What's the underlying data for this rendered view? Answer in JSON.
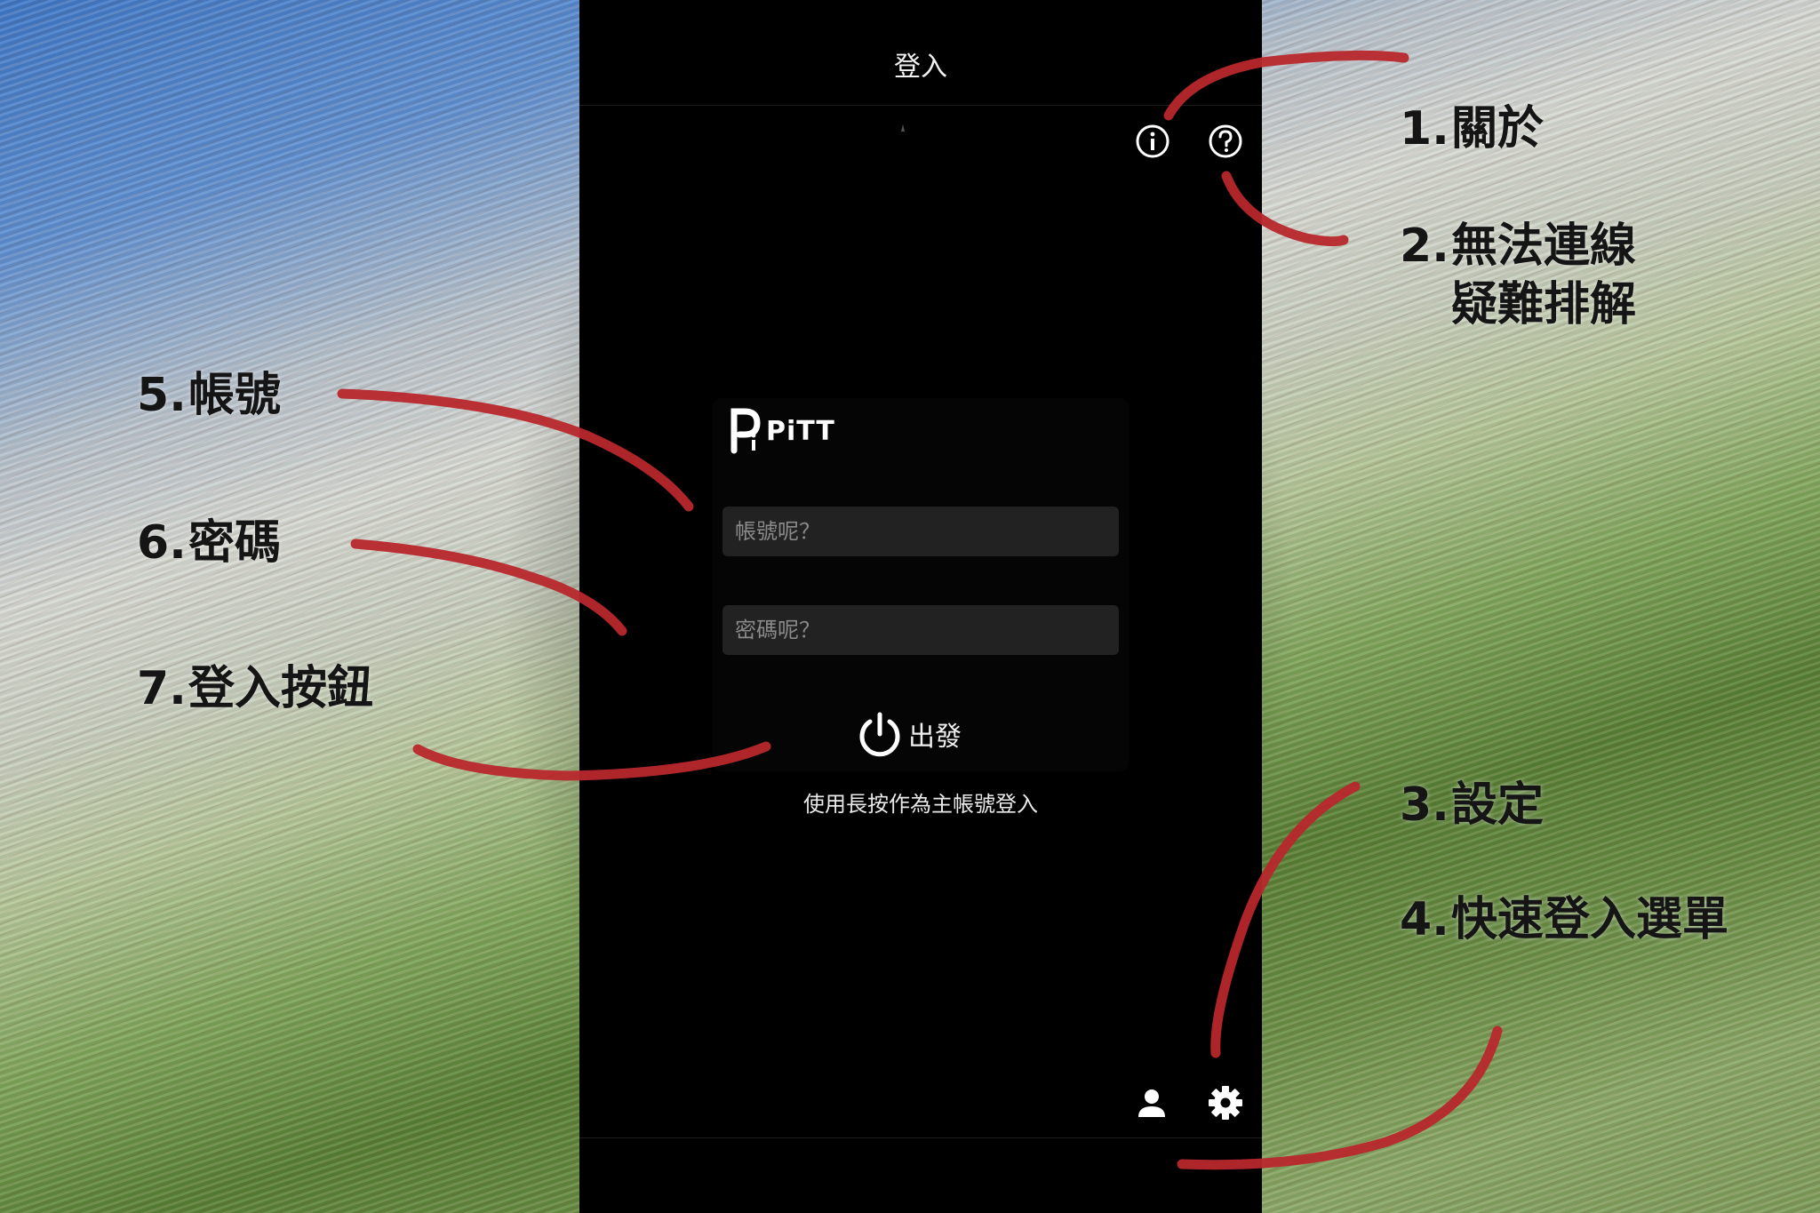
{
  "app": {
    "title": "登入",
    "logo_text": "PiTT",
    "username_placeholder": "帳號呢？",
    "password_placeholder": "密碼呢？",
    "login_button_label": "出發",
    "hint_text": "使用長按作為主帳號登入"
  },
  "icons": {
    "about": "info-icon",
    "troubleshoot": "help-icon",
    "quick_login": "person-icon",
    "settings": "gear-icon",
    "login": "power-icon"
  },
  "annotations": [
    {
      "num": "1.",
      "line1": "關於",
      "line2": ""
    },
    {
      "num": "2.",
      "line1": "無法連線",
      "line2": "疑難排解"
    },
    {
      "num": "3.",
      "line1": "設定",
      "line2": ""
    },
    {
      "num": "4.",
      "line1": "快速登入選單",
      "line2": ""
    },
    {
      "num": "5.",
      "line1": "帳號",
      "line2": ""
    },
    {
      "num": "6.",
      "line1": "密碼",
      "line2": ""
    },
    {
      "num": "7.",
      "line1": "登入按鈕",
      "line2": ""
    }
  ],
  "colors": {
    "annotation_stroke": "#b8282c",
    "screen_background": "#000000",
    "field_background": "#222222"
  }
}
